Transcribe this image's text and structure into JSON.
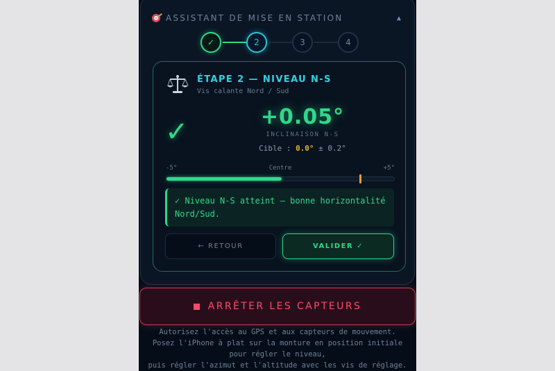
{
  "header": {
    "title": "ASSISTANT DE MISE EN STATION",
    "target_icon": "target-icon",
    "collapse_icon": "chevron-up-icon",
    "collapse_glyph": "▲"
  },
  "stepper": [
    {
      "label": "✓",
      "state": "done"
    },
    {
      "label": "2",
      "state": "active"
    },
    {
      "label": "3",
      "state": "todo"
    },
    {
      "label": "4",
      "state": "todo"
    }
  ],
  "step": {
    "icon": "balance-scale-icon",
    "title": "ÉTAPE 2 — NIVEAU N-S",
    "subtitle": "Vis calante Nord / Sud",
    "check_glyph": "✓",
    "reading": "+0.05°",
    "reading_label": "INCLINAISON N-S",
    "target_prefix": "Cible : ",
    "target_value": "0.0°",
    "target_suffix": " ± 0.2°",
    "scale": {
      "min_label": "-5°",
      "center_label": "Centre",
      "max_label": "+5°"
    },
    "level_bar": {
      "min": -5,
      "max": 5,
      "value": 0.05,
      "marker": 3.5
    },
    "status": "✓ Niveau N-S atteint — bonne horizontalité Nord/Sud.",
    "back_label": "← RETOUR",
    "validate_label": "VALIDER ✓"
  },
  "stop_button": {
    "label": "ARRÊTER LES CAPTEURS"
  },
  "help_lines": [
    "Autorisez l'accès au GPS et aux capteurs de mouvement.",
    "Posez l'iPhone à plat sur la monture en position initiale",
    "pour régler le niveau,",
    "puis régler l'azimut et l'altitude avec les vis de réglage."
  ],
  "colors": {
    "accent_green": "#2ed98a",
    "accent_cyan": "#2ec4d6",
    "warning_amber": "#e3b331",
    "danger_red": "#ff4a6a",
    "background": "#050d18"
  }
}
